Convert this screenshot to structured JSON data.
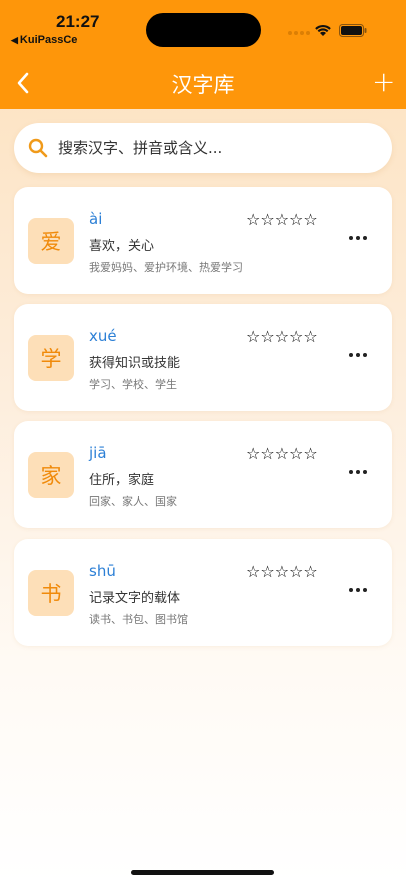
{
  "status_bar": {
    "time": "21:27",
    "back_app": "KuiPassCe"
  },
  "nav": {
    "title": "汉字库",
    "back_icon": "chevron-left-icon",
    "add_label": "+"
  },
  "search": {
    "placeholder": "搜索汉字、拼音或含义..."
  },
  "colors": {
    "accent": "#fe960a",
    "pinyin": "#2d80d6",
    "star": "#f3b800",
    "char_bg": "#fddfb8"
  },
  "characters": [
    {
      "char": "爱",
      "pinyin": "ài",
      "meaning": "喜欢，关心",
      "examples": "我爱妈妈、爱护环境、热爱学习",
      "stars": "☆☆☆☆☆"
    },
    {
      "char": "学",
      "pinyin": "xué",
      "meaning": "获得知识或技能",
      "examples": "学习、学校、学生",
      "stars": "☆☆☆☆☆"
    },
    {
      "char": "家",
      "pinyin": "jiā",
      "meaning": "住所，家庭",
      "examples": "回家、家人、国家",
      "stars": "☆☆☆☆☆"
    },
    {
      "char": "书",
      "pinyin": "shū",
      "meaning": "记录文字的载体",
      "examples": "读书、书包、图书馆",
      "stars": "☆☆☆☆☆"
    }
  ]
}
